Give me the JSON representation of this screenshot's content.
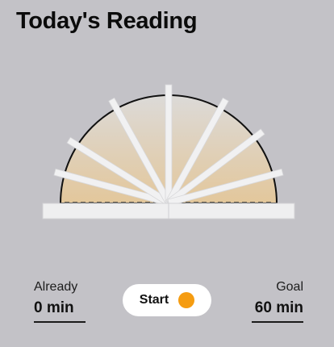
{
  "header": {
    "title": "Today's Reading"
  },
  "stats": {
    "already_label": "Already",
    "already_value": "0 min",
    "goal_label": "Goal",
    "goal_value": "60 min"
  },
  "start_button": {
    "label": "Start",
    "indicator_color": "#f59c11"
  },
  "book_fan": {
    "open_fraction": 0,
    "accent_color": "#e2c9a0"
  }
}
